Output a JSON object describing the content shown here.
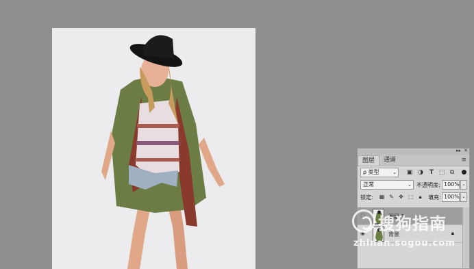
{
  "layers_panel": {
    "tabs": [
      "图层",
      "通道"
    ],
    "filter": {
      "label": "类型"
    },
    "blend_mode": "正常",
    "opacity": {
      "label": "不透明度:",
      "value": "100%"
    },
    "lock": {
      "label": "锁定:"
    },
    "fill": {
      "label": "填充:",
      "value": "100%"
    },
    "layers": [
      {
        "name": "图层 1",
        "selected": true,
        "visible": false
      },
      {
        "name": "背景",
        "selected": false,
        "visible": true,
        "locked": true
      }
    ]
  },
  "watermark": {
    "text": "搜狗指南",
    "url": "zhinan.sogou.com"
  },
  "colors": {
    "workspace": "#8e8e8e",
    "panel": "#d6d6d6",
    "selected_layer": "#9d9d9d"
  }
}
